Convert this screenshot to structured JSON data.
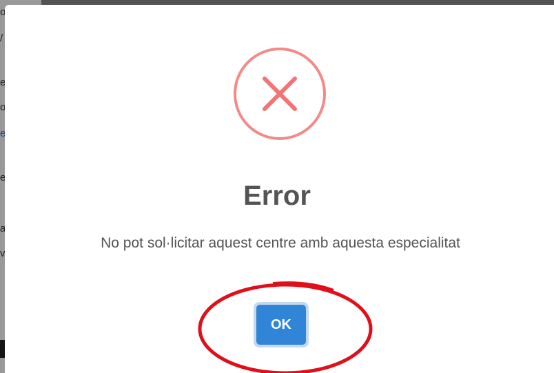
{
  "background_fragments": [
    {
      "text": "o",
      "style": "normal"
    },
    {
      "text": "/",
      "style": "normal"
    },
    {
      "text": "e",
      "style": "normal"
    },
    {
      "text": "o",
      "style": "normal"
    },
    {
      "text": "e",
      "style": "link"
    },
    {
      "text": "e",
      "style": "normal"
    },
    {
      "text": "a",
      "style": "normal"
    },
    {
      "text": "v",
      "style": "normal"
    }
  ],
  "dialog": {
    "icon": "error-x-icon",
    "title": "Error",
    "message": "No pot sol·licitar aquest centre amb aquesta especialitat",
    "confirm_label": "OK"
  },
  "colors": {
    "icon": "#f27474",
    "title": "#545454",
    "confirm_button": "#3085d6",
    "annotation": "#e0101a"
  }
}
